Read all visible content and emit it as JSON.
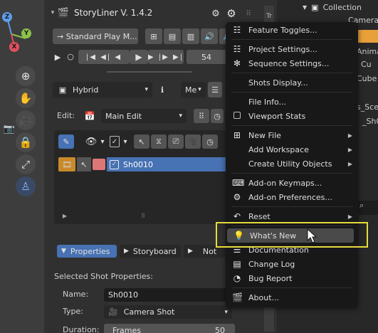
{
  "viewport": {
    "axis_z": "Z",
    "axis_y": "Y",
    "axis_x": "X"
  },
  "panel": {
    "title": "StoryLiner  V. 1.4.2",
    "play_mode": "→ Standard Play M...",
    "frame": "54",
    "layout_mode": "Hybrid",
    "me_label": "Me",
    "edit_label": "Edit:",
    "edit_value": "Main Edit",
    "shot_name": "Sh0010",
    "tabs": [
      "Properties",
      "Storyboard",
      "Not"
    ],
    "section_title": "Selected Shot Properties:",
    "name_label": "Name:",
    "name_value": "Sh0010",
    "type_label": "Type:",
    "type_value": "Camera Shot",
    "duration_label": "Duration:",
    "duration_unit": "Frames",
    "duration_value": "50"
  },
  "outliner": {
    "collection": "Collection",
    "items": [
      "Camera",
      "Anima",
      "Cu",
      "Cube",
      "s_Scen",
      "_Sh0"
    ]
  },
  "menu": {
    "items": [
      {
        "label": "Feature Toggles...",
        "u": "F",
        "icon": "toggles-icon"
      },
      {
        "label": "Project Settings...",
        "u": "P",
        "icon": "project-settings-icon"
      },
      {
        "label": "Sequence Settings...",
        "u": "S",
        "icon": "sequence-settings-icon"
      },
      {
        "label": "Shots Display...",
        "u": "S",
        "icon": ""
      },
      {
        "label": "File Info...",
        "u": "F",
        "icon": ""
      },
      {
        "label": "Viewport Stats",
        "u": "V",
        "icon": "checkbox-icon"
      },
      {
        "label": "New File",
        "u": "N",
        "icon": "new-file-icon"
      },
      {
        "label": "Add Workspace",
        "u": "A",
        "icon": ""
      },
      {
        "label": "Create Utility Objects",
        "u": "C",
        "icon": ""
      },
      {
        "label": "Add-on Keymaps...",
        "u": "A",
        "icon": "keymaps-icon"
      },
      {
        "label": "Add-on Preferences...",
        "u": "A",
        "icon": "preferences-icon"
      },
      {
        "label": "Reset",
        "u": "R",
        "icon": "reset-icon"
      },
      {
        "label": "What's New",
        "u": "W",
        "icon": "whats-new-icon"
      },
      {
        "label": "Documentation",
        "u": "D",
        "icon": "documentation-icon"
      },
      {
        "label": "Change Log",
        "u": "C",
        "icon": "change-log-icon"
      },
      {
        "label": "Bug Report",
        "u": "B",
        "icon": "bug-report-icon"
      },
      {
        "label": "About...",
        "u": "A",
        "icon": "about-icon"
      }
    ]
  },
  "colors": {
    "highlight_box": "#e6dc3a",
    "selected_row": "#4772b3",
    "tab_active": "#4772b3"
  }
}
